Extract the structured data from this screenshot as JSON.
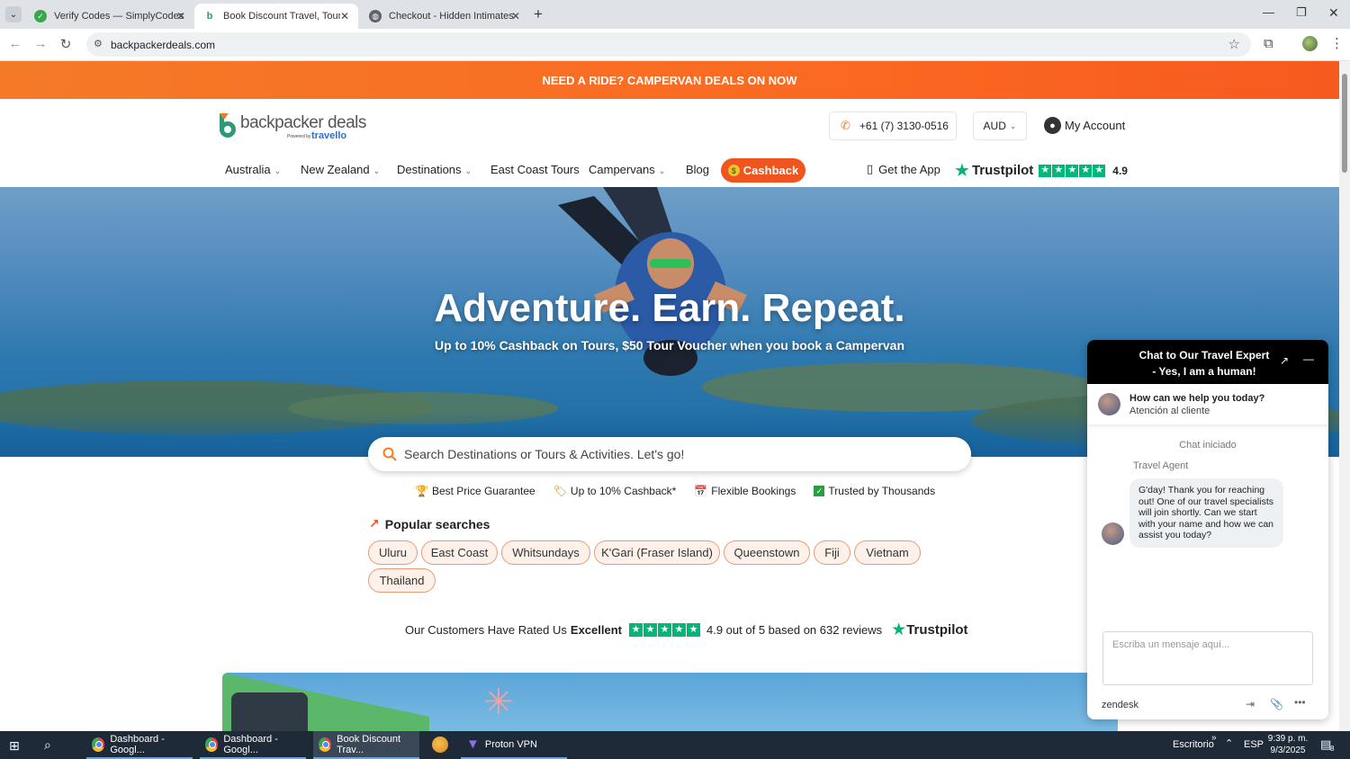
{
  "browser": {
    "tabs": [
      {
        "title": "Verify Codes — SimplyCodes",
        "active": false
      },
      {
        "title": "Book Discount Travel, Tours, and",
        "active": true
      },
      {
        "title": "Checkout - Hidden Intimates",
        "active": false
      }
    ],
    "url": "backpackerdeals.com"
  },
  "promo": {
    "text": "NEED A RIDE? CAMPERVAN DEALS ON NOW"
  },
  "header": {
    "logo_text": "backpacker deals",
    "logo_powered": "Powered by",
    "logo_brand": "travello",
    "phone": "+61 (7) 3130-0516",
    "currency": "AUD",
    "account": "My Account"
  },
  "nav": {
    "items": [
      {
        "label": "Australia",
        "dropdown": true
      },
      {
        "label": "New Zealand",
        "dropdown": true
      },
      {
        "label": "Destinations",
        "dropdown": true
      },
      {
        "label": "East Coast Tours",
        "dropdown": false
      },
      {
        "label": "Campervans",
        "dropdown": true
      },
      {
        "label": "Blog",
        "dropdown": false
      }
    ],
    "cashback": "Cashback",
    "get_app": "Get the App",
    "trustpilot": "Trustpilot",
    "rating": "4.9"
  },
  "hero": {
    "title": "Adventure. Earn. Repeat.",
    "subtitle": "Up to 10% Cashback on Tours, $50 Tour Voucher when you book a Campervan"
  },
  "search": {
    "placeholder": "Search Destinations or Tours & Activities. Let's go!"
  },
  "features": [
    "Best Price Guarantee",
    "Up to 10% Cashback*",
    "Flexible Bookings",
    "Trusted by Thousands"
  ],
  "popular": {
    "title": "Popular searches",
    "items": [
      "Uluru",
      "East Coast",
      "Whitsundays",
      "K'Gari (Fraser Island)",
      "Queenstown",
      "Fiji",
      "Vietnam",
      "Thailand"
    ]
  },
  "rating_bar": {
    "prefix": "Our Customers Have Rated Us",
    "word": "Excellent",
    "summary": "4.9 out of 5 based on 632 reviews",
    "brand": "Trustpilot"
  },
  "chat": {
    "title_line1": "Chat to Our Travel Expert",
    "title_line2": "- Yes, I am a human!",
    "help_title": "How can we help you today?",
    "help_sub": "Atención al cliente",
    "status": "Chat iniciado",
    "agent": "Travel Agent",
    "message": "G'day! Thank you for reaching out!  One of our travel specialists will join shortly. Can we start with your name and how we can assist you today?",
    "input_placeholder": "Escriba un mensaje aquí...",
    "brand": "zendesk"
  },
  "taskbar": {
    "apps": [
      "Dashboard - Googl...",
      "Dashboard - Googl...",
      "Book Discount Trav...",
      "Proton VPN"
    ],
    "desktop": "Escritorio",
    "lang": "ESP",
    "time": "9:39 p. m.",
    "date": "9/3/2025",
    "notif_count": "8"
  },
  "colors": {
    "brand_orange": "#f47a28",
    "trustpilot_green": "#00b67a",
    "chat_header": "#000000"
  }
}
